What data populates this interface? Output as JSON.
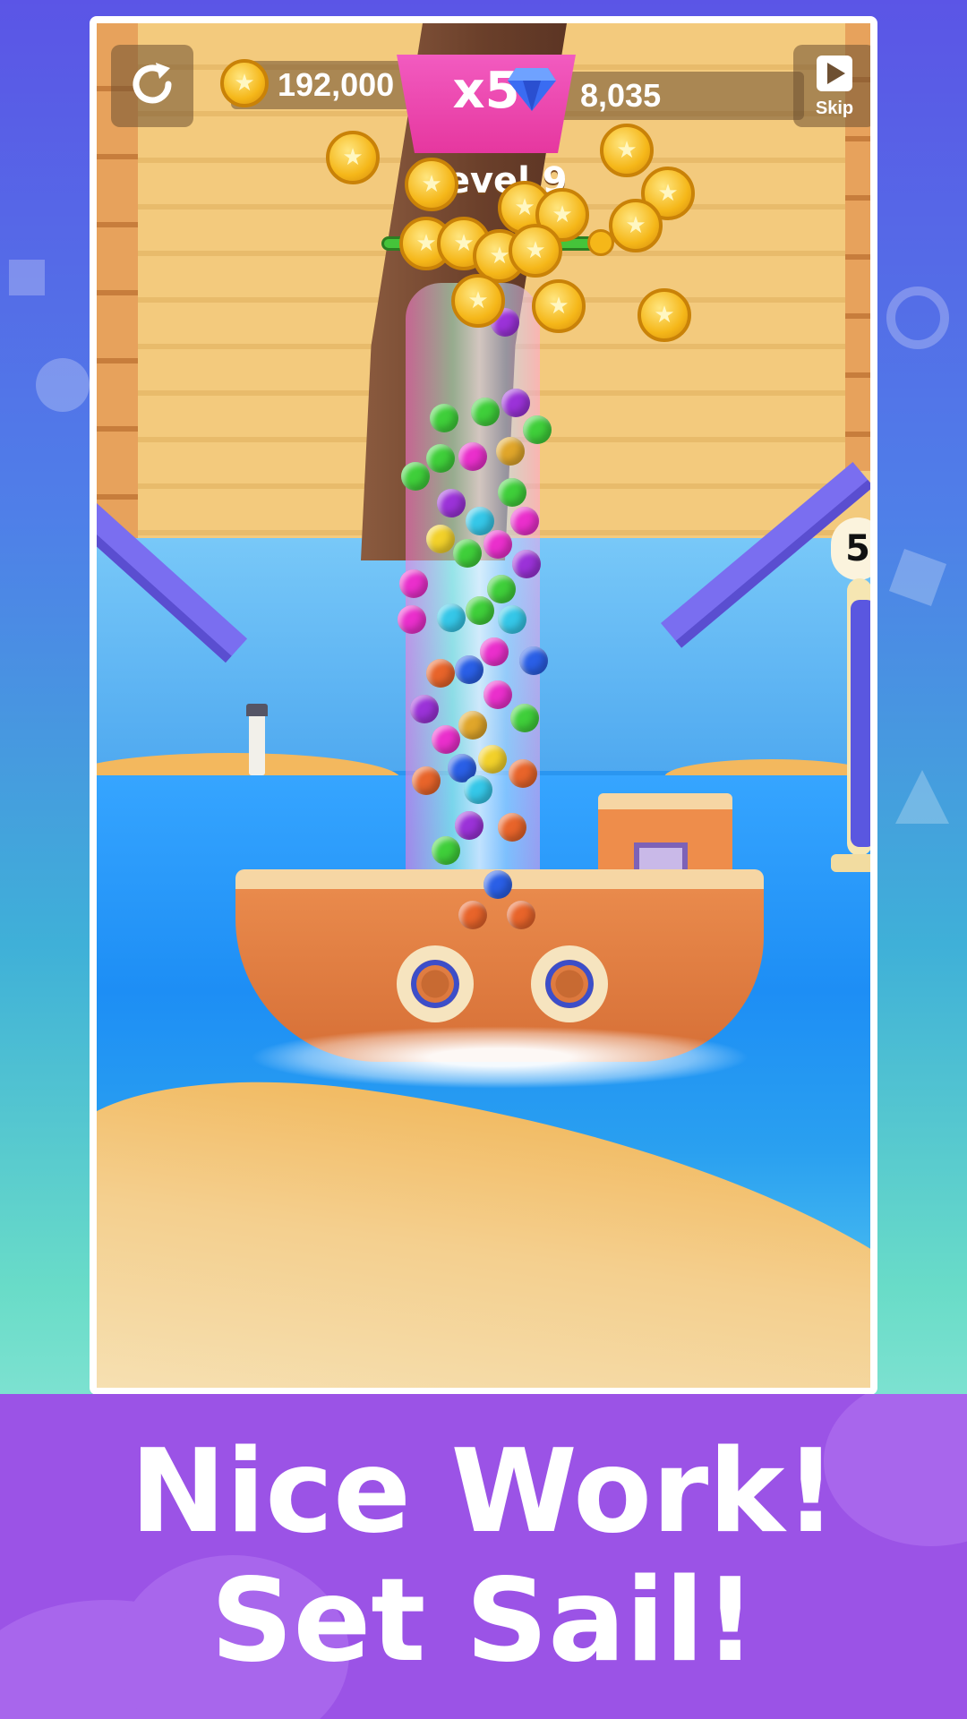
{
  "hud": {
    "coins": "192,000",
    "gems": "8,035",
    "multiplier": "x5",
    "level": "Level 9",
    "skip_label": "Skip",
    "fill_count": "5",
    "fill_fraction": 0.95
  },
  "banner": {
    "line1": "Nice Work!",
    "line2": "Set Sail!"
  },
  "icons": {
    "restart": "restart-icon",
    "skip": "play-icon",
    "coin": "coin-icon",
    "gem": "diamond-icon"
  },
  "colors": {
    "banner_bg": "#9b53e6",
    "meter_fill": "#5a57e0",
    "multiplier": "#e6379f"
  }
}
